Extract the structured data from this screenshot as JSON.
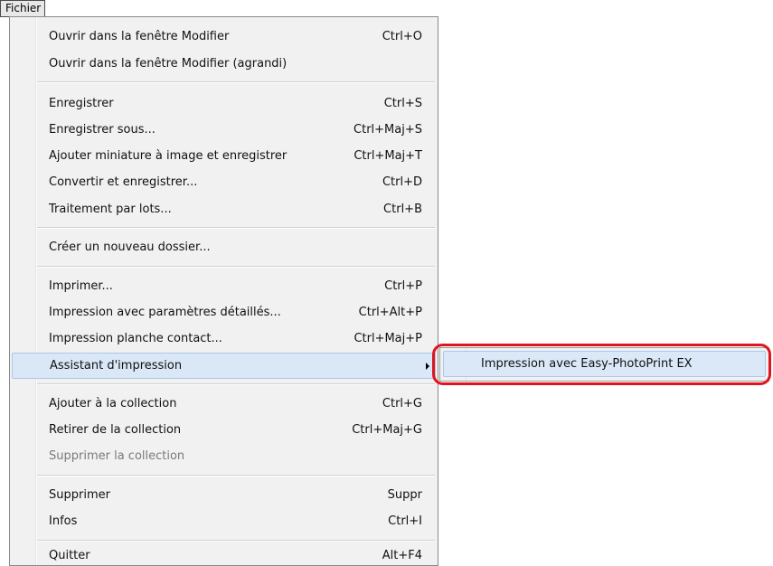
{
  "menubar": {
    "title": "Fichier"
  },
  "menu": {
    "items": [
      {
        "label": "Ouvrir dans la fenêtre Modifier",
        "shortcut": "Ctrl+O"
      },
      {
        "label": "Ouvrir dans la fenêtre Modifier (agrandi)",
        "shortcut": ""
      },
      {
        "label": "Enregistrer",
        "shortcut": "Ctrl+S"
      },
      {
        "label": "Enregistrer sous...",
        "shortcut": "Ctrl+Maj+S"
      },
      {
        "label": "Ajouter miniature à image et enregistrer",
        "shortcut": "Ctrl+Maj+T"
      },
      {
        "label": "Convertir et enregistrer...",
        "shortcut": "Ctrl+D"
      },
      {
        "label": "Traitement par lots...",
        "shortcut": "Ctrl+B"
      },
      {
        "label": "Créer un nouveau dossier...",
        "shortcut": ""
      },
      {
        "label": "Imprimer...",
        "shortcut": "Ctrl+P"
      },
      {
        "label": "Impression avec paramètres détaillés...",
        "shortcut": "Ctrl+Alt+P"
      },
      {
        "label": "Impression planche contact...",
        "shortcut": "Ctrl+Maj+P"
      },
      {
        "label": "Assistant d'impression",
        "shortcut": ""
      },
      {
        "label": "Ajouter à la collection",
        "shortcut": "Ctrl+G"
      },
      {
        "label": "Retirer de la collection",
        "shortcut": "Ctrl+Maj+G"
      },
      {
        "label": "Supprimer la collection",
        "shortcut": ""
      },
      {
        "label": "Supprimer",
        "shortcut": "Suppr"
      },
      {
        "label": "Infos",
        "shortcut": "Ctrl+I"
      },
      {
        "label": "Quitter",
        "shortcut": "Alt+F4"
      }
    ]
  },
  "submenu": {
    "items": [
      {
        "label": "Impression avec Easy-PhotoPrint EX"
      }
    ]
  },
  "colors": {
    "callout": "#e0141e",
    "highlight": "#d9e7f7"
  }
}
